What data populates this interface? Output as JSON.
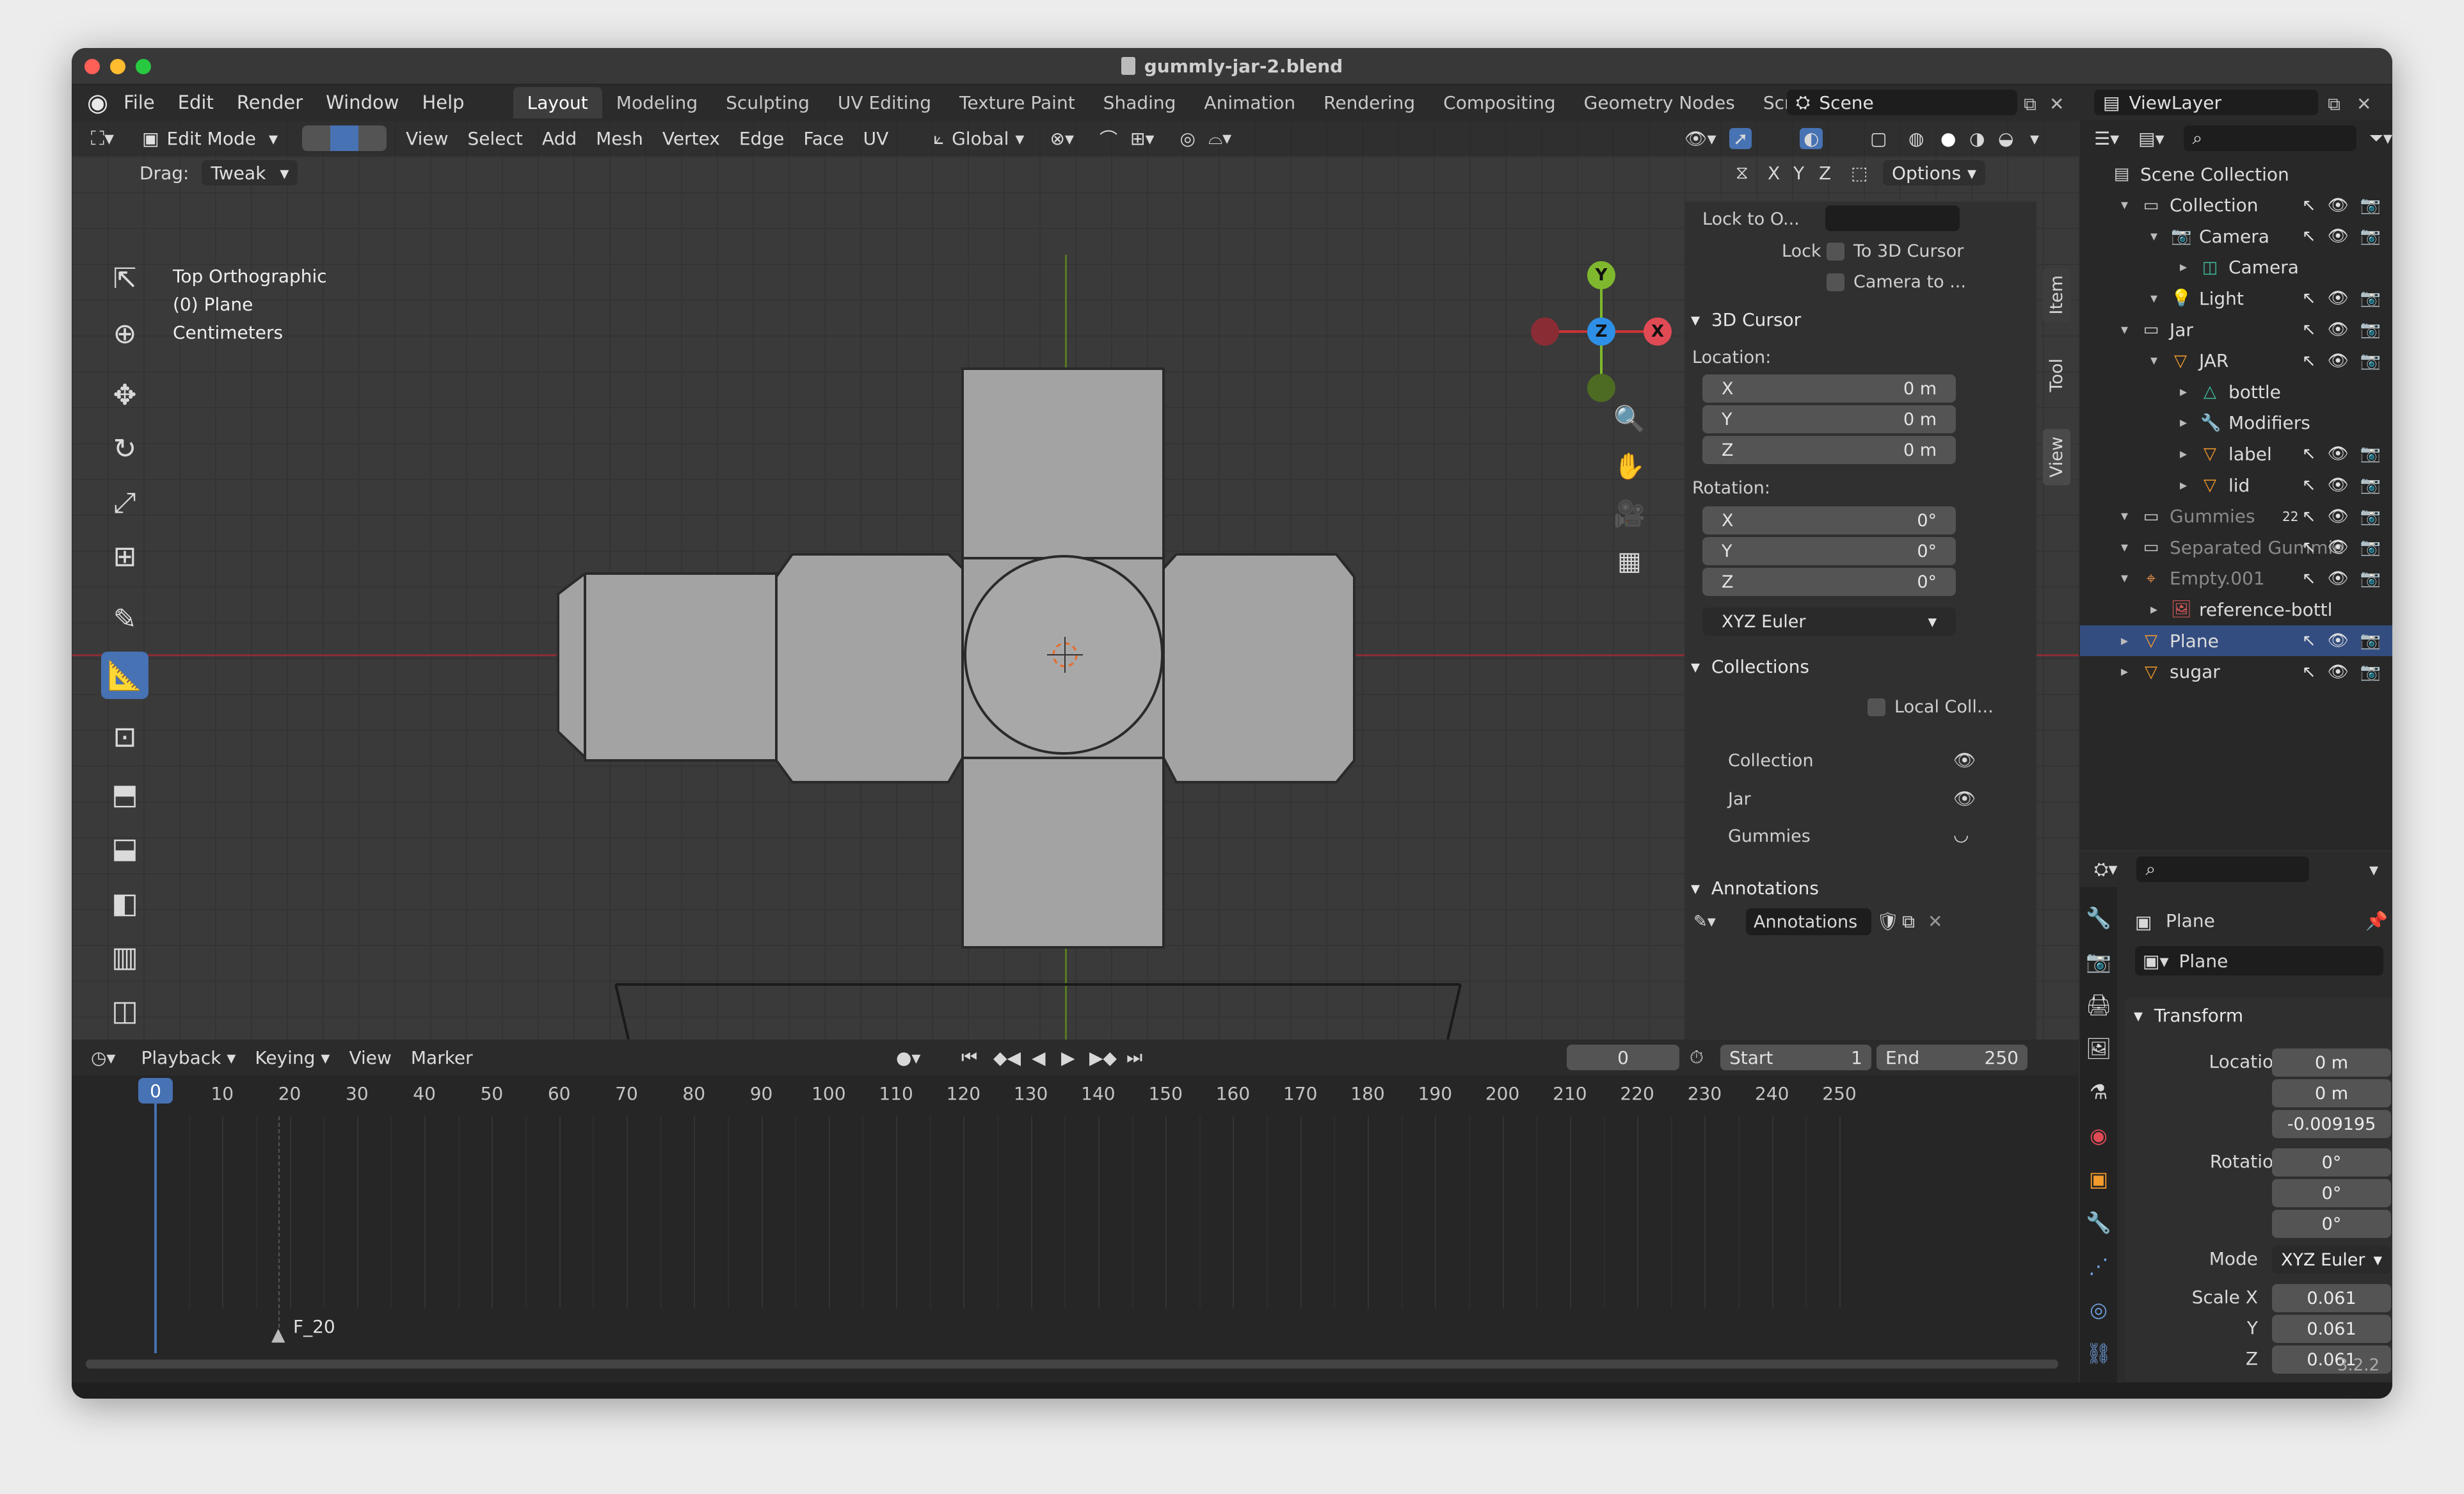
{
  "window": {
    "title": "gummly-jar-2.blend",
    "version": "3.2.2"
  },
  "menu": [
    "File",
    "Edit",
    "Render",
    "Window",
    "Help"
  ],
  "workspaces": [
    "Layout",
    "Modeling",
    "Sculpting",
    "UV Editing",
    "Texture Paint",
    "Shading",
    "Animation",
    "Rendering",
    "Compositing",
    "Geometry Nodes",
    "Scripting"
  ],
  "scene": "Scene",
  "view_layer": "ViewLayer",
  "viewport_header": {
    "mode": "Edit Mode",
    "menus": [
      "View",
      "Select",
      "Add",
      "Mesh",
      "Vertex",
      "Edge",
      "Face",
      "UV"
    ],
    "orientation": "Global",
    "drag_label": "Drag:",
    "drag_value": "Tweak",
    "options": "Options"
  },
  "overlay": {
    "view": "Top Orthographic",
    "object": "(0) Plane",
    "units": "Centimeters"
  },
  "npanel": {
    "tabs": [
      "Item",
      "Tool",
      "View"
    ],
    "lock_to_object": "Lock to O...",
    "lock_label": "Lock",
    "to_3d_cursor": "To 3D Cursor",
    "camera_to": "Camera to ...",
    "cursor_header": "3D Cursor",
    "location_label": "Location:",
    "rotation_label": "Rotation:",
    "location": [
      {
        "axis": "X",
        "value": "0 m"
      },
      {
        "axis": "Y",
        "value": "0 m"
      },
      {
        "axis": "Z",
        "value": "0 m"
      }
    ],
    "rotation": [
      {
        "axis": "X",
        "value": "0°"
      },
      {
        "axis": "Y",
        "value": "0°"
      },
      {
        "axis": "Z",
        "value": "0°"
      }
    ],
    "rotation_mode": "XYZ Euler",
    "collections_header": "Collections",
    "local_coll": "Local Coll...",
    "collections": [
      "Collection",
      "Jar",
      "Gummies"
    ],
    "annotations_header": "Annotations",
    "annotations_field": "Annotations"
  },
  "outliner": {
    "rows": [
      {
        "label": "Scene Collection",
        "indent": 0,
        "icon": "scene-collection-icon"
      },
      {
        "label": "Collection",
        "indent": 1,
        "icon": "collection-icon"
      },
      {
        "label": "Camera",
        "indent": 2,
        "icon": "camera-icon"
      },
      {
        "label": "Camera",
        "indent": 3,
        "icon": "camera-data-icon"
      },
      {
        "label": "Light",
        "indent": 2,
        "icon": "light-icon"
      },
      {
        "label": "Jar",
        "indent": 1,
        "icon": "collection-icon"
      },
      {
        "label": "JAR",
        "indent": 2,
        "icon": "mesh-object-icon"
      },
      {
        "label": "bottle",
        "indent": 3,
        "icon": "mesh-data-icon"
      },
      {
        "label": "Modifiers",
        "indent": 3,
        "icon": "wrench-icon"
      },
      {
        "label": "label",
        "indent": 3,
        "icon": "mesh-object-icon"
      },
      {
        "label": "lid",
        "indent": 3,
        "icon": "mesh-object-icon"
      },
      {
        "label": "Gummies",
        "indent": 1,
        "icon": "collection-icon"
      },
      {
        "label": "Separated Gummie",
        "indent": 1,
        "icon": "collection-icon"
      },
      {
        "label": "Empty.001",
        "indent": 1,
        "icon": "empty-icon"
      },
      {
        "label": "reference-bottl",
        "indent": 2,
        "icon": "image-icon"
      },
      {
        "label": "Plane",
        "indent": 1,
        "icon": "mesh-object-icon"
      },
      {
        "label": "sugar",
        "indent": 1,
        "icon": "mesh-object-icon"
      }
    ],
    "gummies_count": "22"
  },
  "properties": {
    "object_name": "Plane",
    "object_field": "Plane",
    "transform_header": "Transform",
    "location_label": "Location X",
    "rotation_label": "Rotation X",
    "scale_label": "Scale X",
    "mode_label": "Mode",
    "location": [
      "0 m",
      "0 m",
      "-0.009195"
    ],
    "rotation": [
      "0°",
      "0°",
      "0°"
    ],
    "mode": "XYZ Euler",
    "scale": [
      "0.061",
      "0.061",
      "0.061"
    ],
    "axis_y": "Y",
    "axis_z": "Z"
  },
  "timeline": {
    "menus": [
      "Playback",
      "Keying",
      "View",
      "Marker"
    ],
    "current_frame": "0",
    "start_label": "Start",
    "start": "1",
    "end_label": "End",
    "end": "250",
    "ticks": [
      "0",
      "10",
      "20",
      "30",
      "40",
      "50",
      "60",
      "70",
      "80",
      "90",
      "100",
      "110",
      "120",
      "130",
      "140",
      "150",
      "160",
      "170",
      "180",
      "190",
      "200",
      "210",
      "220",
      "230",
      "240",
      "250"
    ],
    "marker": "F_20"
  },
  "colors": {
    "accent": "#4772b3",
    "x_axis": "#e04a55",
    "y_axis": "#7fb82e",
    "z_axis": "#2e8fe6",
    "selected_row": "#334d80"
  }
}
